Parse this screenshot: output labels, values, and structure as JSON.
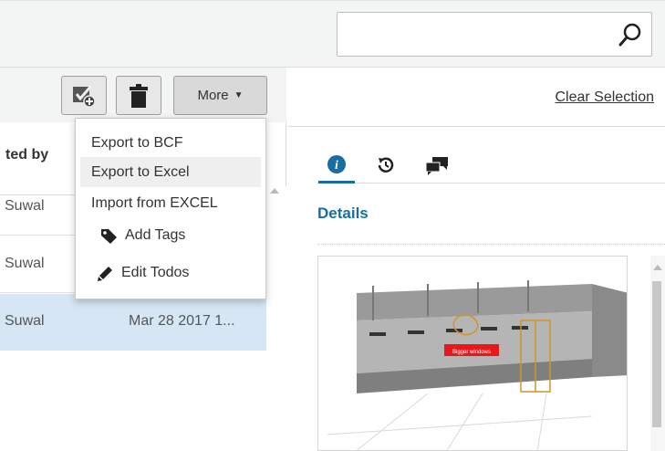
{
  "search": {
    "placeholder": "",
    "value": ""
  },
  "toolbar": {
    "more_label": "More"
  },
  "table": {
    "header": "ted by",
    "rows": [
      {
        "name": "Suwal",
        "date": ""
      },
      {
        "name": "Suwal",
        "date": ""
      },
      {
        "name": "Suwal",
        "date": "Mar 28 2017 1..."
      }
    ]
  },
  "more_menu": {
    "items": [
      {
        "label": "Export to BCF"
      },
      {
        "label": "Export to Excel"
      },
      {
        "label": "Import from EXCEL"
      },
      {
        "label": "Add Tags",
        "icon": "tag-icon"
      },
      {
        "label": "Edit Todos",
        "icon": "pencil-icon"
      }
    ]
  },
  "right": {
    "clear_selection": "Clear Selection",
    "tabs": [
      {
        "icon": "info-icon"
      },
      {
        "icon": "history-icon"
      },
      {
        "icon": "comments-icon"
      }
    ],
    "details_heading": "Details",
    "snapshot_label": "Bigger windows"
  },
  "colors": {
    "accent": "#1a6da3",
    "selected_row": "#d6e6f4",
    "toolbar_bg": "#f3f4f4",
    "label_red": "#e8171a"
  }
}
